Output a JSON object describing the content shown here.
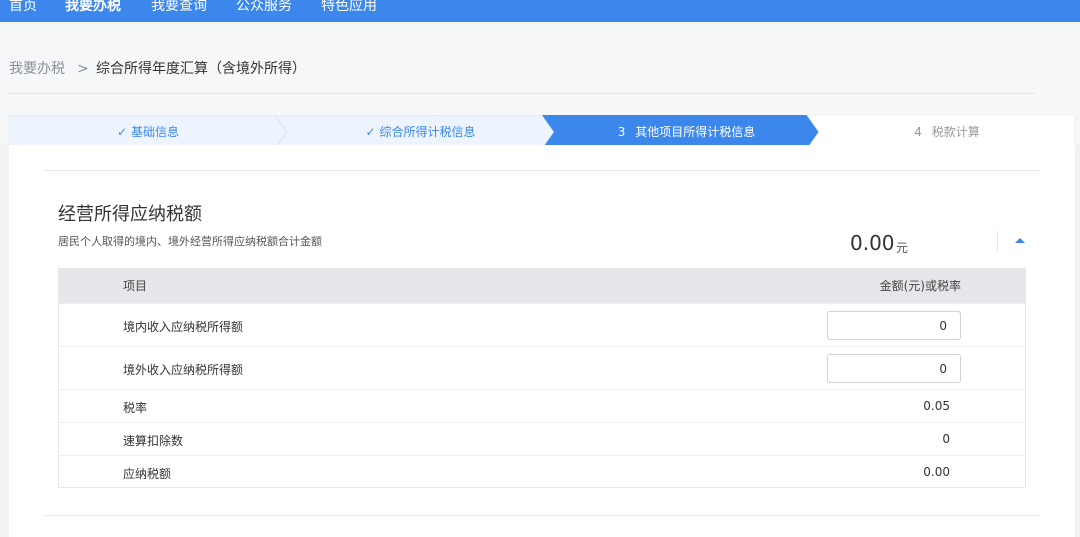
{
  "topnav": {
    "items": [
      "首页",
      "我要办税",
      "我要查询",
      "公众服务",
      "特色应用"
    ],
    "active_index": 1
  },
  "breadcrumb": {
    "home": "我要办税",
    "separator": ">",
    "current": "综合所得年度汇算（含境外所得）"
  },
  "steps": [
    {
      "label": "基础信息",
      "status": "done"
    },
    {
      "label": "综合所得计税信息",
      "status": "done"
    },
    {
      "number": "3",
      "label": "其他项目所得计税信息",
      "status": "current"
    },
    {
      "number": "4",
      "label": "税款计算",
      "status": "todo"
    }
  ],
  "section": {
    "title": "经营所得应纳税额",
    "description": "居民个人取得的境内、境外经营所得应纳税额合计金额",
    "total_value": "0.00",
    "total_unit": "元"
  },
  "table": {
    "headers": [
      "项目",
      "金额(元)或税率"
    ],
    "rows": [
      {
        "name": "境内收入应纳税所得额",
        "value": "0"
      },
      {
        "name": "境外收入应纳税所得额",
        "value": "0"
      },
      {
        "name": "税率",
        "value": "0.05"
      },
      {
        "name": "速算扣除数",
        "value": "0"
      },
      {
        "name": "应纳税额",
        "value": "0.00"
      }
    ]
  },
  "colors": {
    "nav_bg": "#3c87ec",
    "step_done_bg": "#eef4fd",
    "step_current_bg": "#3c87ec",
    "step_todo_bg": "#ffffff",
    "table_header_bg": "#e6e7ea"
  },
  "icons": {
    "step_done": "check-icon",
    "collapse": "caret-up-icon"
  }
}
